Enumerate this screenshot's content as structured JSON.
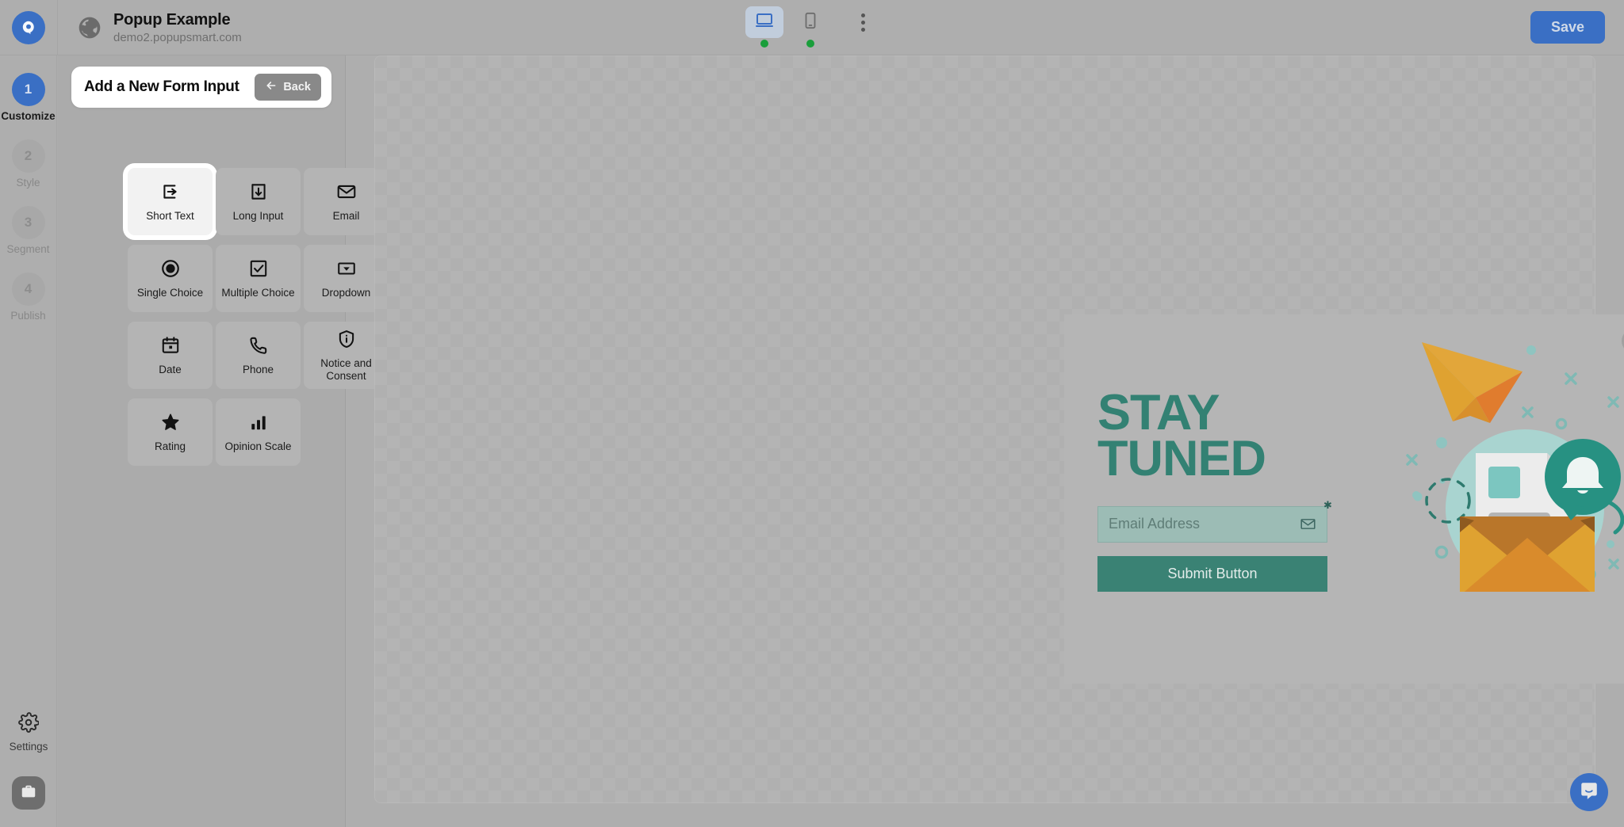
{
  "header": {
    "logo_icon": "popupsmart-logo-icon",
    "globe_icon": "globe-icon",
    "site_title": "Popup Example",
    "site_url": "demo2.popupsmart.com",
    "desktop_icon": "desktop-monitor-icon",
    "mobile_icon": "mobile-phone-icon",
    "kebab_icon": "more-options-icon",
    "save_label": "Save",
    "accent_color": "#3a6fc4",
    "status_dot_color": "#1a9e3b"
  },
  "rail": {
    "steps": [
      {
        "number": "1",
        "label": "Customize",
        "active": true
      },
      {
        "number": "2",
        "label": "Style",
        "active": false
      },
      {
        "number": "3",
        "label": "Segment",
        "active": false
      },
      {
        "number": "4",
        "label": "Publish",
        "active": false
      }
    ],
    "settings_label": "Settings",
    "settings_icon": "gear-icon",
    "briefcase_icon": "briefcase-icon"
  },
  "panel": {
    "title": "Add a New Form Input",
    "back_label": "Back",
    "back_icon": "arrow-left-icon",
    "inputs": [
      {
        "label": "Short Text",
        "icon": "short-text-icon",
        "selected": true
      },
      {
        "label": "Long Input",
        "icon": "long-input-icon",
        "selected": false
      },
      {
        "label": "Email",
        "icon": "envelope-icon",
        "selected": false
      },
      {
        "label": "Single Choice",
        "icon": "radio-button-icon",
        "selected": false
      },
      {
        "label": "Multiple Choice",
        "icon": "checkbox-icon",
        "selected": false
      },
      {
        "label": "Dropdown",
        "icon": "dropdown-icon",
        "selected": false
      },
      {
        "label": "Date",
        "icon": "calendar-icon",
        "selected": false
      },
      {
        "label": "Phone",
        "icon": "phone-icon",
        "selected": false
      },
      {
        "label": "Notice and Consent",
        "icon": "shield-info-icon",
        "selected": false
      },
      {
        "label": "Rating",
        "icon": "star-icon",
        "selected": false
      },
      {
        "label": "Opinion Scale",
        "icon": "bar-chart-icon",
        "selected": false
      }
    ]
  },
  "popup": {
    "headline_line1": "STAY",
    "headline_line2": "TUNED",
    "email_placeholder": "Email Address",
    "email_icon": "envelope-icon",
    "required_marker": "✱",
    "submit_label": "Submit Button",
    "close_icon": "close-icon",
    "illustration_icon": "newsletter-illustration",
    "brand_green": "#338173",
    "field_green": "#9cbcb5",
    "button_green": "#3a8274"
  },
  "chat": {
    "icon": "chat-bubble-icon"
  }
}
